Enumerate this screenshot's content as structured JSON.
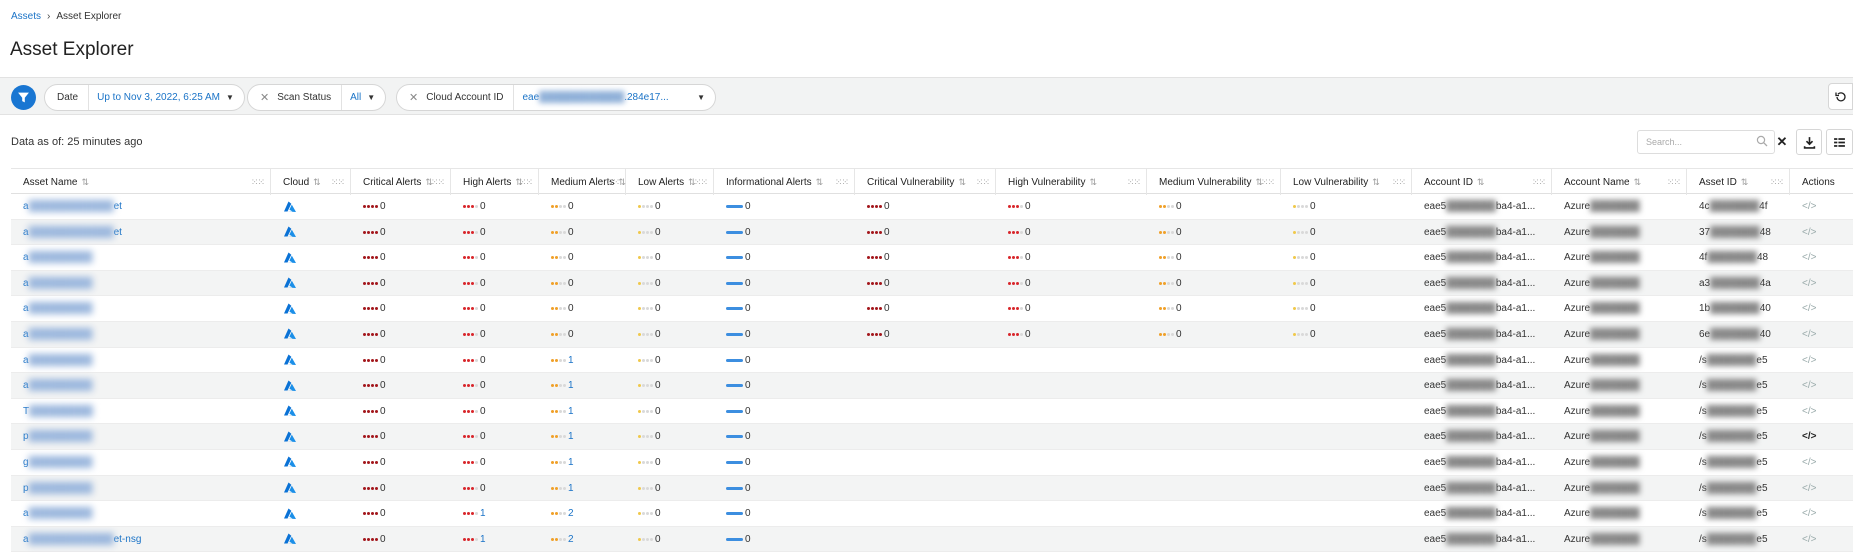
{
  "breadcrumb": {
    "parent": "Assets",
    "current": "Asset Explorer"
  },
  "page_title": "Asset Explorer",
  "filters": {
    "date": {
      "label": "Date",
      "value": "Up to Nov 3, 2022, 6:25 AM"
    },
    "scan_status": {
      "label": "Scan Status",
      "value": "All"
    },
    "cloud_account": {
      "label": "Cloud Account ID",
      "value_prefix": "eae",
      "value_suffix": ".284e17..."
    }
  },
  "data_as_of": "Data as of: 25 minutes ago",
  "search": {
    "placeholder": "Search..."
  },
  "columns": [
    {
      "label": "Asset Name"
    },
    {
      "label": "Cloud"
    },
    {
      "label": "Critical Alerts"
    },
    {
      "label": "High Alerts"
    },
    {
      "label": "Medium Alerts"
    },
    {
      "label": "Low Alerts"
    },
    {
      "label": "Informational Alerts"
    },
    {
      "label": "Critical Vulnerability"
    },
    {
      "label": "High Vulnerability"
    },
    {
      "label": "Medium Vulnerability"
    },
    {
      "label": "Low Vulnerability"
    },
    {
      "label": "Account ID"
    },
    {
      "label": "Account Name"
    },
    {
      "label": "Asset ID"
    },
    {
      "label": "Actions"
    }
  ],
  "colors": {
    "critical": "#a3171c",
    "high": "#d8262b",
    "medium": "#f0a028",
    "low": "#f0c84a",
    "info": "#3c8ee0",
    "accent": "#1976d2"
  },
  "rows": [
    {
      "name_start": "a",
      "name_end": "et",
      "crit": "0",
      "high": "0",
      "med": "0",
      "low": "0",
      "info": "0",
      "cv": "0",
      "hv": "0",
      "mv": "0",
      "lv": "0",
      "acct_prefix": "eae5",
      "acct_suffix": "ba4-a1...",
      "acct_name": "Azure",
      "asset_id_prefix": "4c",
      "asset_id_suffix": "4f"
    },
    {
      "name_start": "a",
      "name_end": "et",
      "crit": "0",
      "high": "0",
      "med": "0",
      "low": "0",
      "info": "0",
      "cv": "0",
      "hv": "0",
      "mv": "0",
      "lv": "0",
      "acct_prefix": "eae5",
      "acct_suffix": "ba4-a1...",
      "acct_name": "Azure",
      "asset_id_prefix": "37",
      "asset_id_suffix": "48"
    },
    {
      "name_start": "a",
      "name_end": "",
      "crit": "0",
      "high": "0",
      "med": "0",
      "low": "0",
      "info": "0",
      "cv": "0",
      "hv": "0",
      "mv": "0",
      "lv": "0",
      "acct_prefix": "eae5",
      "acct_suffix": "ba4-a1...",
      "acct_name": "Azure",
      "asset_id_prefix": "4f",
      "asset_id_suffix": "48"
    },
    {
      "name_start": "a",
      "name_end": "",
      "crit": "0",
      "high": "0",
      "med": "0",
      "low": "0",
      "info": "0",
      "cv": "0",
      "hv": "0",
      "mv": "0",
      "lv": "0",
      "acct_prefix": "eae5",
      "acct_suffix": "ba4-a1...",
      "acct_name": "Azure",
      "asset_id_prefix": "a3",
      "asset_id_suffix": "4a"
    },
    {
      "name_start": "a",
      "name_end": "",
      "crit": "0",
      "high": "0",
      "med": "0",
      "low": "0",
      "info": "0",
      "cv": "0",
      "hv": "0",
      "mv": "0",
      "lv": "0",
      "acct_prefix": "eae5",
      "acct_suffix": "ba4-a1...",
      "acct_name": "Azure",
      "asset_id_prefix": "1b",
      "asset_id_suffix": "40"
    },
    {
      "name_start": "a",
      "name_end": "",
      "crit": "0",
      "high": "0",
      "med": "0",
      "low": "0",
      "info": "0",
      "cv": "0",
      "hv": "0",
      "mv": "0",
      "lv": "0",
      "acct_prefix": "eae5",
      "acct_suffix": "ba4-a1...",
      "acct_name": "Azure",
      "asset_id_prefix": "6e",
      "asset_id_suffix": "40"
    },
    {
      "name_start": "a",
      "name_end": "",
      "crit": "0",
      "high": "0",
      "med": "1",
      "low": "0",
      "info": "0",
      "cv": "",
      "hv": "",
      "mv": "",
      "lv": "",
      "acct_prefix": "eae5",
      "acct_suffix": "ba4-a1...",
      "acct_name": "Azure",
      "asset_id_prefix": "/s",
      "asset_id_suffix": "e5"
    },
    {
      "name_start": "a",
      "name_end": "",
      "crit": "0",
      "high": "0",
      "med": "1",
      "low": "0",
      "info": "0",
      "cv": "",
      "hv": "",
      "mv": "",
      "lv": "",
      "acct_prefix": "eae5",
      "acct_suffix": "ba4-a1...",
      "acct_name": "Azure",
      "asset_id_prefix": "/s",
      "asset_id_suffix": "e5"
    },
    {
      "name_start": "T",
      "name_end": "",
      "crit": "0",
      "high": "0",
      "med": "1",
      "low": "0",
      "info": "0",
      "cv": "",
      "hv": "",
      "mv": "",
      "lv": "",
      "acct_prefix": "eae5",
      "acct_suffix": "ba4-a1...",
      "acct_name": "Azure",
      "asset_id_prefix": "/s",
      "asset_id_suffix": "e5"
    },
    {
      "name_start": "p",
      "name_end": "",
      "crit": "0",
      "high": "0",
      "med": "1",
      "low": "0",
      "info": "0",
      "cv": "",
      "hv": "",
      "mv": "",
      "lv": "",
      "acct_prefix": "eae5",
      "acct_suffix": "ba4-a1...",
      "acct_name": "Azure",
      "asset_id_prefix": "/s",
      "asset_id_suffix": "e5"
    },
    {
      "name_start": "g",
      "name_end": "",
      "crit": "0",
      "high": "0",
      "med": "1",
      "low": "0",
      "info": "0",
      "cv": "",
      "hv": "",
      "mv": "",
      "lv": "",
      "acct_prefix": "eae5",
      "acct_suffix": "ba4-a1...",
      "acct_name": "Azure",
      "asset_id_prefix": "/s",
      "asset_id_suffix": "e5"
    },
    {
      "name_start": "p",
      "name_end": "",
      "crit": "0",
      "high": "0",
      "med": "1",
      "low": "0",
      "info": "0",
      "cv": "",
      "hv": "",
      "mv": "",
      "lv": "",
      "acct_prefix": "eae5",
      "acct_suffix": "ba4-a1...",
      "acct_name": "Azure",
      "asset_id_prefix": "/s",
      "asset_id_suffix": "e5"
    },
    {
      "name_start": "a",
      "name_end": "",
      "crit": "0",
      "high": "1",
      "med": "2",
      "low": "0",
      "info": "0",
      "cv": "",
      "hv": "",
      "mv": "",
      "lv": "",
      "acct_prefix": "eae5",
      "acct_suffix": "ba4-a1...",
      "acct_name": "Azure",
      "asset_id_prefix": "/s",
      "asset_id_suffix": "e5"
    },
    {
      "name_start": "a",
      "name_end": "et-nsg",
      "crit": "0",
      "high": "1",
      "med": "2",
      "low": "0",
      "info": "0",
      "cv": "",
      "hv": "",
      "mv": "",
      "lv": "",
      "acct_prefix": "eae5",
      "acct_suffix": "ba4-a1...",
      "acct_name": "Azure",
      "asset_id_prefix": "/s",
      "asset_id_suffix": "e5"
    }
  ]
}
